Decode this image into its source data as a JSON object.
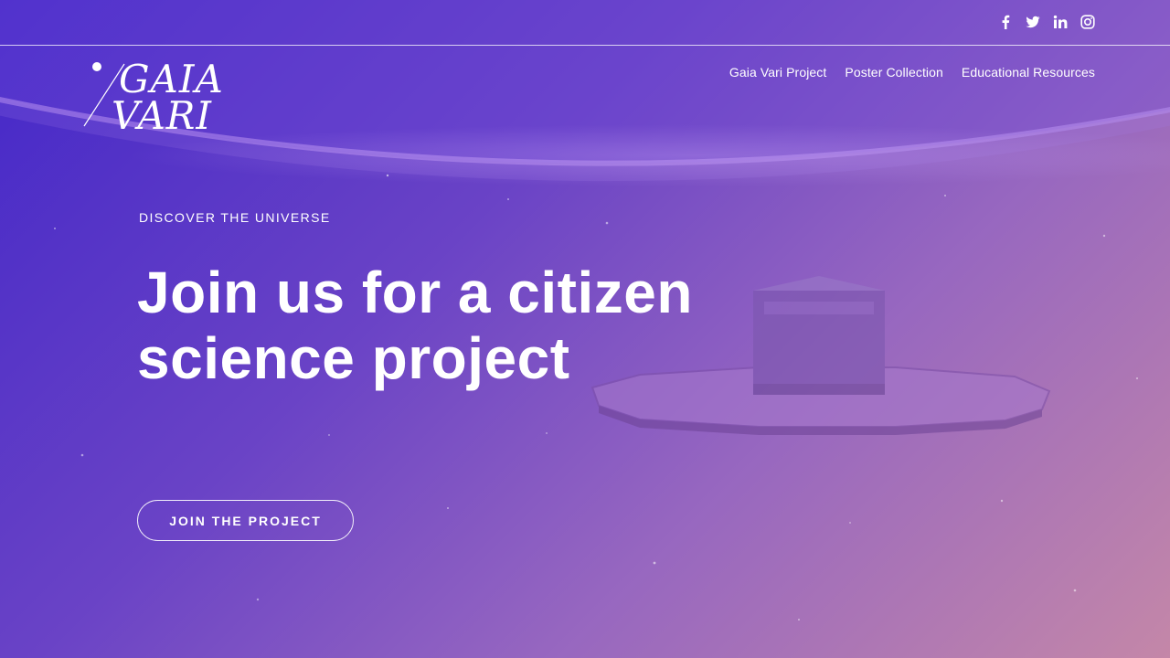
{
  "social": [
    {
      "name": "facebook-icon",
      "glyph": "facebook"
    },
    {
      "name": "twitter-icon",
      "glyph": "twitter"
    },
    {
      "name": "linkedin-icon",
      "glyph": "linkedin"
    },
    {
      "name": "instagram-icon",
      "glyph": "instagram"
    }
  ],
  "logo": {
    "line1": "GAIA",
    "line2": "VARI"
  },
  "nav": {
    "items": [
      {
        "label": "Gaia Vari Project"
      },
      {
        "label": "Poster Collection"
      },
      {
        "label": "Educational Resources"
      }
    ]
  },
  "hero": {
    "eyebrow": "DISCOVER THE UNIVERSE",
    "headline_line1": "Join us for a citizen",
    "headline_line2": "science project",
    "cta_label": "JOIN THE PROJECT"
  },
  "colors": {
    "gradient_start": "#4327c8",
    "gradient_mid": "#9767c0",
    "gradient_end": "#c487a8",
    "text": "#ffffff"
  }
}
